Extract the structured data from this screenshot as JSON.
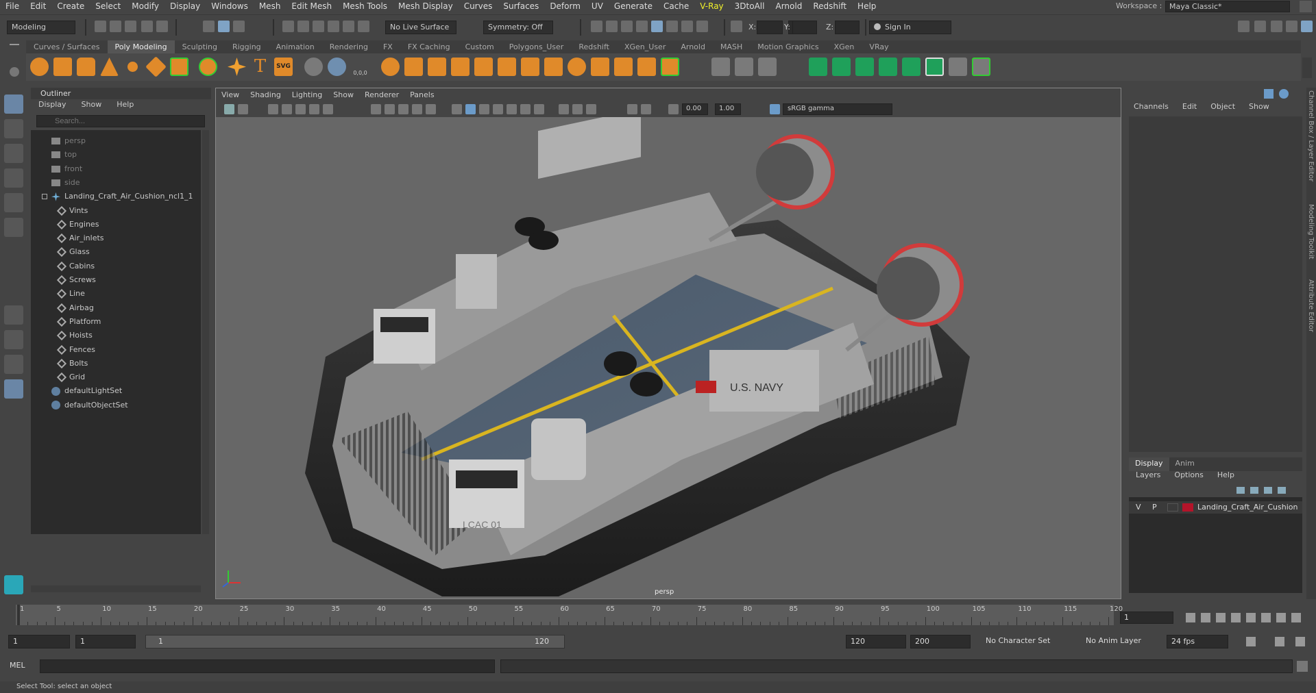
{
  "menubar": {
    "items": [
      "File",
      "Edit",
      "Create",
      "Select",
      "Modify",
      "Display",
      "Windows",
      "Mesh",
      "Edit Mesh",
      "Mesh Tools",
      "Mesh Display",
      "Curves",
      "Surfaces",
      "Deform",
      "UV",
      "Generate",
      "Cache",
      "V-Ray",
      "3DtoAll",
      "Arnold",
      "Redshift",
      "Help"
    ],
    "workspace_label": "Workspace :",
    "workspace_value": "Maya Classic*"
  },
  "statusline": {
    "mode": "Modeling",
    "live_surface": "No Live Surface",
    "symmetry": "Symmetry: Off",
    "x_label": "X:",
    "y_label": "Y:",
    "z_label": "Z:",
    "sign_in": "Sign In"
  },
  "shelf": {
    "tabs": [
      "Curves / Surfaces",
      "Poly Modeling",
      "Sculpting",
      "Rigging",
      "Animation",
      "Rendering",
      "FX",
      "FX Caching",
      "Custom",
      "Polygons_User",
      "Redshift",
      "XGen_User",
      "Arnold",
      "MASH",
      "Motion Graphics",
      "XGen",
      "VRay"
    ],
    "active_tab": "Poly Modeling",
    "text_icon": "T",
    "svg_icon": "SVG",
    "coord_icon": "0,0,0"
  },
  "outliner": {
    "title": "Outliner",
    "menu": [
      "Display",
      "Show",
      "Help"
    ],
    "search_placeholder": "Search...",
    "cameras": [
      "persp",
      "top",
      "front",
      "side"
    ],
    "root": "Landing_Craft_Air_Cushion_ncl1_1",
    "children": [
      "Vints",
      "Engines",
      "Air_inlets",
      "Glass",
      "Cabins",
      "Screws",
      "Line",
      "Airbag",
      "Platform",
      "Hoists",
      "Fences",
      "Bolts",
      "Grid"
    ],
    "sets": [
      "defaultLightSet",
      "defaultObjectSet"
    ]
  },
  "viewport": {
    "menu": [
      "View",
      "Shading",
      "Lighting",
      "Show",
      "Renderer",
      "Panels"
    ],
    "exposure": "0.00",
    "gamma": "1.00",
    "color_space": "sRGB gamma",
    "camera": "persp",
    "hull_text": "U.S. NAVY",
    "hull_text_2": "LCAC 01"
  },
  "channelbox": {
    "menu": [
      "Channels",
      "Edit",
      "Object",
      "Show"
    ],
    "side_tabs": [
      "Channel Box / Layer Editor",
      "Modeling Toolkit",
      "Attribute Editor"
    ]
  },
  "layers": {
    "tabs": [
      "Display",
      "Anim"
    ],
    "active_tab": "Display",
    "menu": [
      "Layers",
      "Options",
      "Help"
    ],
    "row": {
      "v": "V",
      "p": "P",
      "name": "Landing_Craft_Air_Cushion",
      "color": "#b4142a"
    }
  },
  "timeline": {
    "ticks": [
      1,
      5,
      10,
      15,
      20,
      25,
      30,
      35,
      40,
      45,
      50,
      55,
      60,
      65,
      70,
      75,
      80,
      85,
      90,
      95,
      100,
      105,
      110,
      115,
      120
    ],
    "current_frame": "1"
  },
  "range": {
    "start": "1",
    "playback_start": "1",
    "slider_start": "1",
    "slider_end": "120",
    "playback_end": "120",
    "end": "200",
    "character_set": "No Character Set",
    "anim_layer": "No Anim Layer",
    "fps": "24 fps"
  },
  "cmdline": {
    "label": "MEL"
  },
  "helpline": {
    "text": "Select Tool: select an object"
  },
  "colors": {
    "accent": "#6a86a6",
    "vray": "#f2f22a",
    "deck_line": "#d9b520",
    "fan_ring": "#d13b3b"
  }
}
